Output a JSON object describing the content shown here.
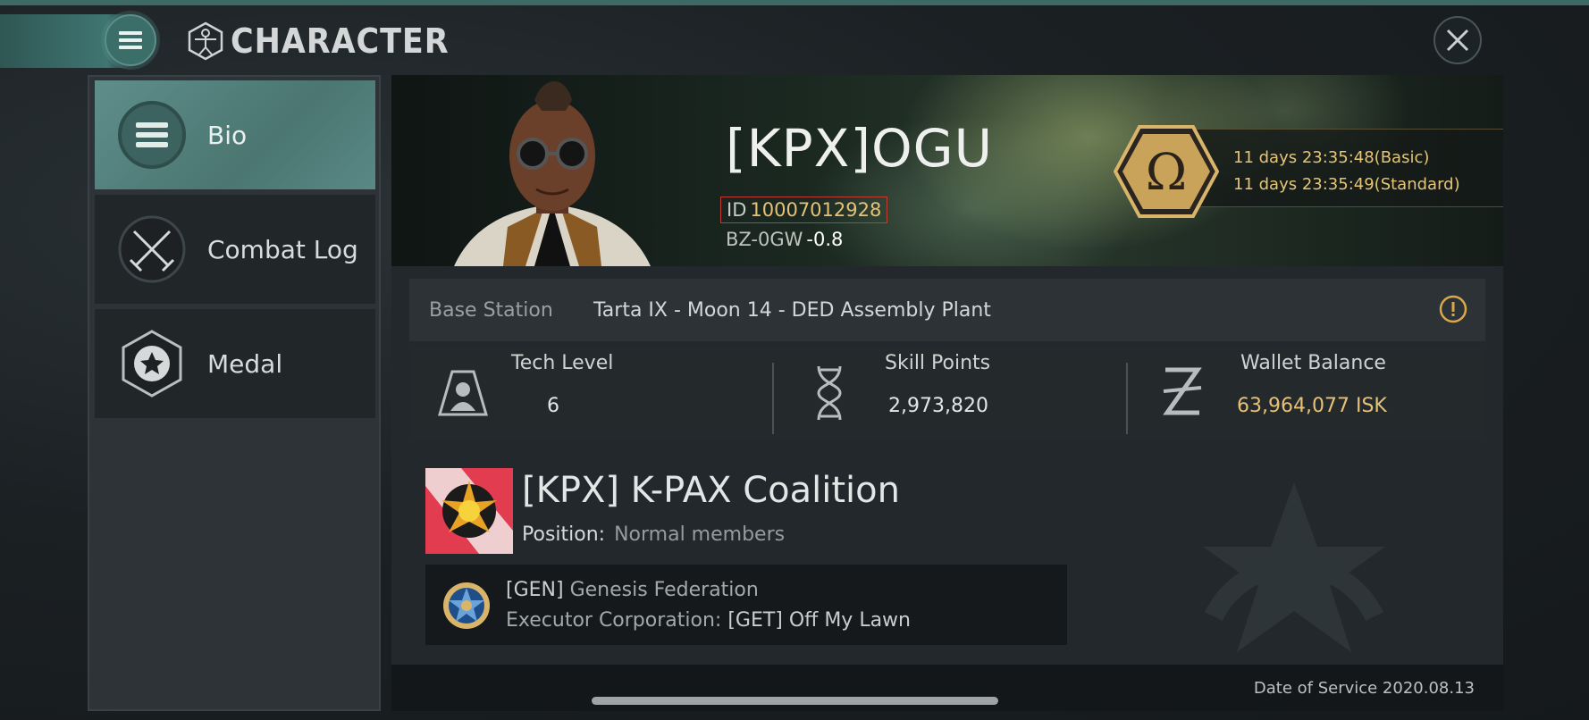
{
  "header": {
    "title": "CHARACTER",
    "menu_icon": "hamburger-menu-icon",
    "close_icon": "close-icon"
  },
  "sidebar": {
    "items": [
      {
        "label": "Bio",
        "icon": "list-icon",
        "active": true
      },
      {
        "label": "Combat Log",
        "icon": "crossed-swords-icon",
        "active": false
      },
      {
        "label": "Medal",
        "icon": "star-medal-icon",
        "active": false
      }
    ]
  },
  "profile": {
    "name": "[KPX]OGU",
    "id_label": "ID",
    "id_value": "10007012928",
    "location": "BZ-0GW",
    "security": "-0.8",
    "omega_line1": "11 days 23:35:48(Basic)",
    "omega_line2": "11 days 23:35:49(Standard)",
    "omega_icon": "omega-icon"
  },
  "station": {
    "label": "Base Station",
    "value": "Tarta IX - Moon 14 - DED Assembly Plant",
    "icon": "warning-icon"
  },
  "stats": [
    {
      "title": "Tech Level",
      "value": "6",
      "icon": "tech-level-icon"
    },
    {
      "title": "Skill Points",
      "value": "2,973,820",
      "icon": "dna-icon"
    },
    {
      "title": "Wallet Balance",
      "value": "63,964,077 ISK",
      "icon": "isk-icon"
    }
  ],
  "corporation": {
    "name": "[KPX] K-PAX Coalition",
    "position_label": "Position:",
    "position_value": "Normal members",
    "alliance_tag": "[GEN]",
    "alliance_name": "Genesis Federation",
    "executor_label": "Executor Corporation:",
    "executor_value": "[GET] Off My Lawn"
  },
  "footer": {
    "date_of_service": "Date of Service 2020.08.13"
  },
  "colors": {
    "accent_teal": "#4b7672",
    "gold": "#e7c175",
    "id_border": "#c23b2f"
  }
}
